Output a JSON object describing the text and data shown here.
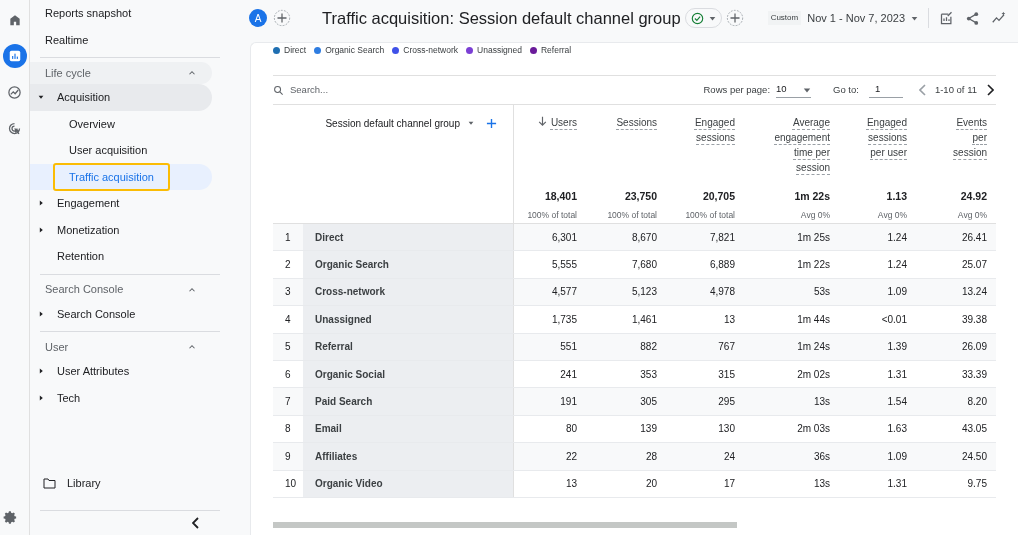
{
  "rail_icons": [
    {
      "kind": "home",
      "selected": false
    },
    {
      "kind": "reports",
      "selected": true
    },
    {
      "kind": "explore",
      "selected": false
    },
    {
      "kind": "advertising",
      "selected": false
    }
  ],
  "sidebar": {
    "top_items": [
      {
        "label": "Reports snapshot",
        "selected": false
      },
      {
        "label": "Realtime",
        "selected": false
      }
    ],
    "sections": [
      {
        "title": "Life cycle",
        "expanded": true,
        "items": [
          {
            "label": "Acquisition",
            "expanded": true,
            "children": [
              {
                "label": "Overview",
                "selected": false
              },
              {
                "label": "User acquisition",
                "selected": false
              },
              {
                "label": "Traffic acquisition",
                "selected": true
              }
            ]
          },
          {
            "label": "Engagement",
            "expanded": false
          },
          {
            "label": "Monetization",
            "expanded": false
          },
          {
            "label": "Retention"
          }
        ]
      },
      {
        "title": "Search Console",
        "expanded": true,
        "items": [
          {
            "label": "Search Console",
            "expanded": false
          }
        ]
      },
      {
        "title": "User",
        "expanded": true,
        "items": [
          {
            "label": "User Attributes",
            "expanded": false
          },
          {
            "label": "Tech",
            "expanded": false
          }
        ]
      }
    ],
    "library": "Library"
  },
  "header": {
    "avatar": "A",
    "title": "Traffic acquisition: Session default channel group",
    "date_label": "Custom",
    "date_range": "Nov 1 - Nov 7, 2023"
  },
  "legend": [
    {
      "label": "Direct",
      "color": "#1f6fb2"
    },
    {
      "label": "Organic Search",
      "color": "#2f7de1"
    },
    {
      "label": "Cross-network",
      "color": "#3f51e8"
    },
    {
      "label": "Unassigned",
      "color": "#7b3fd4"
    },
    {
      "label": "Referral",
      "color": "#6a1b9a"
    }
  ],
  "toolbar": {
    "search_placeholder": "Search...",
    "rows_per_page_label": "Rows per page:",
    "rows_per_page": "10",
    "goto_label": "Go to:",
    "goto": "1",
    "range": "1-10 of 11"
  },
  "table": {
    "dimension": "Session default channel group",
    "columns": [
      {
        "label": "Users",
        "sorted": true
      },
      {
        "label": "Sessions",
        "sorted": false
      },
      {
        "label": "Engaged sessions",
        "sorted": false
      },
      {
        "label": "Average engagement time per session",
        "sorted": false
      },
      {
        "label": "Engaged sessions per user",
        "sorted": false
      },
      {
        "label": "Events per session",
        "sorted": false
      }
    ],
    "totals": [
      {
        "value": "18,401",
        "sub": "100% of total"
      },
      {
        "value": "23,750",
        "sub": "100% of total"
      },
      {
        "value": "20,705",
        "sub": "100% of total"
      },
      {
        "value": "1m 22s",
        "sub": "Avg 0%"
      },
      {
        "value": "1.13",
        "sub": "Avg 0%"
      },
      {
        "value": "24.92",
        "sub": "Avg 0%"
      }
    ],
    "rows": [
      {
        "number": "1",
        "channel": "Direct",
        "values": [
          "6,301",
          "8,670",
          "7,821",
          "1m 25s",
          "1.24",
          "26.41"
        ]
      },
      {
        "number": "2",
        "channel": "Organic Search",
        "values": [
          "5,555",
          "7,680",
          "6,889",
          "1m 22s",
          "1.24",
          "25.07"
        ]
      },
      {
        "number": "3",
        "channel": "Cross-network",
        "values": [
          "4,577",
          "5,123",
          "4,978",
          "53s",
          "1.09",
          "13.24"
        ]
      },
      {
        "number": "4",
        "channel": "Unassigned",
        "values": [
          "1,735",
          "1,461",
          "13",
          "1m 44s",
          "<0.01",
          "39.38"
        ]
      },
      {
        "number": "5",
        "channel": "Referral",
        "values": [
          "551",
          "882",
          "767",
          "1m 24s",
          "1.39",
          "26.09"
        ]
      },
      {
        "number": "6",
        "channel": "Organic Social",
        "values": [
          "241",
          "353",
          "315",
          "2m 02s",
          "1.31",
          "33.39"
        ]
      },
      {
        "number": "7",
        "channel": "Paid Search",
        "values": [
          "191",
          "305",
          "295",
          "13s",
          "1.54",
          "8.20"
        ]
      },
      {
        "number": "8",
        "channel": "Email",
        "values": [
          "80",
          "139",
          "130",
          "2m 03s",
          "1.63",
          "43.05"
        ]
      },
      {
        "number": "9",
        "channel": "Affiliates",
        "values": [
          "22",
          "28",
          "24",
          "36s",
          "1.09",
          "24.50"
        ]
      },
      {
        "number": "10",
        "channel": "Organic Video",
        "values": [
          "13",
          "20",
          "17",
          "13s",
          "1.31",
          "9.75"
        ]
      }
    ]
  }
}
